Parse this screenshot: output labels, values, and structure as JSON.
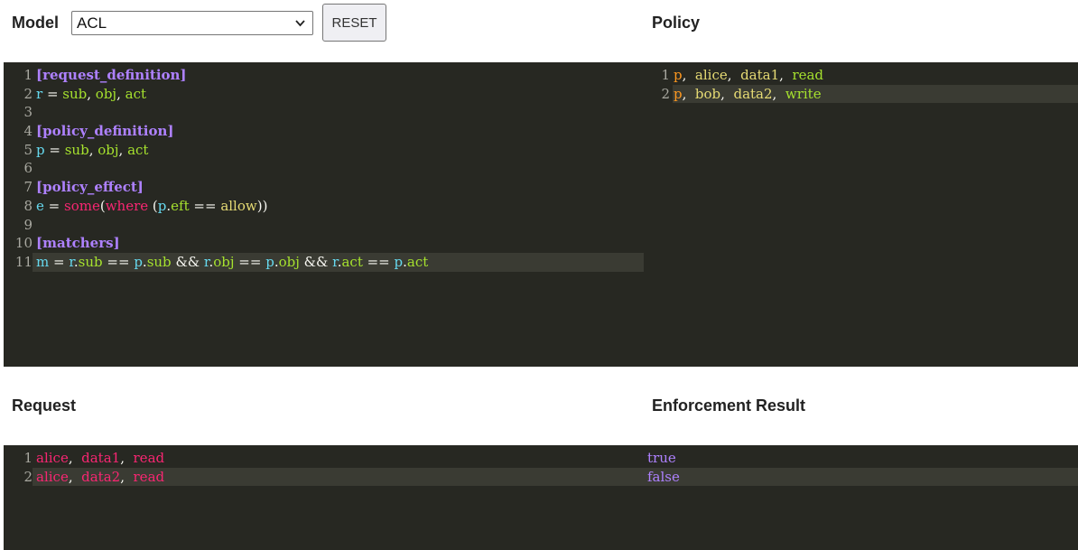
{
  "model": {
    "label": "Model",
    "selected": "ACL",
    "reset_label": "RESET"
  },
  "policy": {
    "label": "Policy"
  },
  "request": {
    "label": "Request"
  },
  "result": {
    "label": "Enforcement Result"
  },
  "model_code": [
    {
      "n": "1",
      "tokens": [
        {
          "t": "[request_definition]",
          "c": "purple"
        }
      ]
    },
    {
      "n": "2",
      "tokens": [
        {
          "t": "r",
          "c": "cyan"
        },
        {
          "t": " = ",
          "c": "white"
        },
        {
          "t": "sub",
          "c": "green"
        },
        {
          "t": ", ",
          "c": "white"
        },
        {
          "t": "obj",
          "c": "green"
        },
        {
          "t": ", ",
          "c": "white"
        },
        {
          "t": "act",
          "c": "green"
        }
      ]
    },
    {
      "n": "3",
      "tokens": []
    },
    {
      "n": "4",
      "tokens": [
        {
          "t": "[policy_definition]",
          "c": "purple"
        }
      ]
    },
    {
      "n": "5",
      "tokens": [
        {
          "t": "p",
          "c": "cyan"
        },
        {
          "t": " = ",
          "c": "white"
        },
        {
          "t": "sub",
          "c": "green"
        },
        {
          "t": ", ",
          "c": "white"
        },
        {
          "t": "obj",
          "c": "green"
        },
        {
          "t": ", ",
          "c": "white"
        },
        {
          "t": "act",
          "c": "green"
        }
      ]
    },
    {
      "n": "6",
      "tokens": []
    },
    {
      "n": "7",
      "tokens": [
        {
          "t": "[policy_effect]",
          "c": "purple"
        }
      ]
    },
    {
      "n": "8",
      "tokens": [
        {
          "t": "e",
          "c": "cyan"
        },
        {
          "t": " = ",
          "c": "white"
        },
        {
          "t": "some",
          "c": "pink"
        },
        {
          "t": "(",
          "c": "white"
        },
        {
          "t": "where",
          "c": "pink"
        },
        {
          "t": " (",
          "c": "white"
        },
        {
          "t": "p",
          "c": "cyan"
        },
        {
          "t": ".",
          "c": "white"
        },
        {
          "t": "eft",
          "c": "green"
        },
        {
          "t": " == ",
          "c": "white"
        },
        {
          "t": "allow",
          "c": "yellow"
        },
        {
          "t": "))",
          "c": "white"
        }
      ]
    },
    {
      "n": "9",
      "tokens": []
    },
    {
      "n": "10",
      "tokens": [
        {
          "t": "[matchers]",
          "c": "purple"
        }
      ]
    },
    {
      "n": "11",
      "active": true,
      "tokens": [
        {
          "t": "m",
          "c": "cyan"
        },
        {
          "t": " = ",
          "c": "white"
        },
        {
          "t": "r",
          "c": "cyan"
        },
        {
          "t": ".",
          "c": "white"
        },
        {
          "t": "sub",
          "c": "green"
        },
        {
          "t": " == ",
          "c": "white"
        },
        {
          "t": "p",
          "c": "cyan"
        },
        {
          "t": ".",
          "c": "white"
        },
        {
          "t": "sub",
          "c": "green"
        },
        {
          "t": " && ",
          "c": "white"
        },
        {
          "t": "r",
          "c": "cyan"
        },
        {
          "t": ".",
          "c": "white"
        },
        {
          "t": "obj",
          "c": "green"
        },
        {
          "t": " == ",
          "c": "white"
        },
        {
          "t": "p",
          "c": "cyan"
        },
        {
          "t": ".",
          "c": "white"
        },
        {
          "t": "obj",
          "c": "green"
        },
        {
          "t": " && ",
          "c": "white"
        },
        {
          "t": "r",
          "c": "cyan"
        },
        {
          "t": ".",
          "c": "white"
        },
        {
          "t": "act",
          "c": "green"
        },
        {
          "t": " == ",
          "c": "white"
        },
        {
          "t": "p",
          "c": "cyan"
        },
        {
          "t": ".",
          "c": "white"
        },
        {
          "t": "act",
          "c": "green"
        }
      ]
    }
  ],
  "policy_code": [
    {
      "n": "1",
      "tokens": [
        {
          "t": "p",
          "c": "orange"
        },
        {
          "t": ",  ",
          "c": "white"
        },
        {
          "t": "alice",
          "c": "yellow"
        },
        {
          "t": ",  ",
          "c": "white"
        },
        {
          "t": "data1",
          "c": "yellow"
        },
        {
          "t": ",  ",
          "c": "white"
        },
        {
          "t": "read",
          "c": "green"
        }
      ]
    },
    {
      "n": "2",
      "active": true,
      "tokens": [
        {
          "t": "p",
          "c": "orange"
        },
        {
          "t": ",  ",
          "c": "white"
        },
        {
          "t": "bob",
          "c": "yellow"
        },
        {
          "t": ",  ",
          "c": "white"
        },
        {
          "t": "data2",
          "c": "yellow"
        },
        {
          "t": ",  ",
          "c": "white"
        },
        {
          "t": "write",
          "c": "green"
        }
      ]
    }
  ],
  "request_code": [
    {
      "n": "1",
      "tokens": [
        {
          "t": "alice",
          "c": "red"
        },
        {
          "t": ",  ",
          "c": "white"
        },
        {
          "t": "data1",
          "c": "red"
        },
        {
          "t": ",  ",
          "c": "white"
        },
        {
          "t": "read",
          "c": "red"
        }
      ]
    },
    {
      "n": "2",
      "active": true,
      "tokens": [
        {
          "t": "alice",
          "c": "red"
        },
        {
          "t": ",  ",
          "c": "white"
        },
        {
          "t": "data2",
          "c": "red"
        },
        {
          "t": ",  ",
          "c": "white"
        },
        {
          "t": "read",
          "c": "red"
        }
      ]
    }
  ],
  "results": [
    "true",
    "false"
  ]
}
